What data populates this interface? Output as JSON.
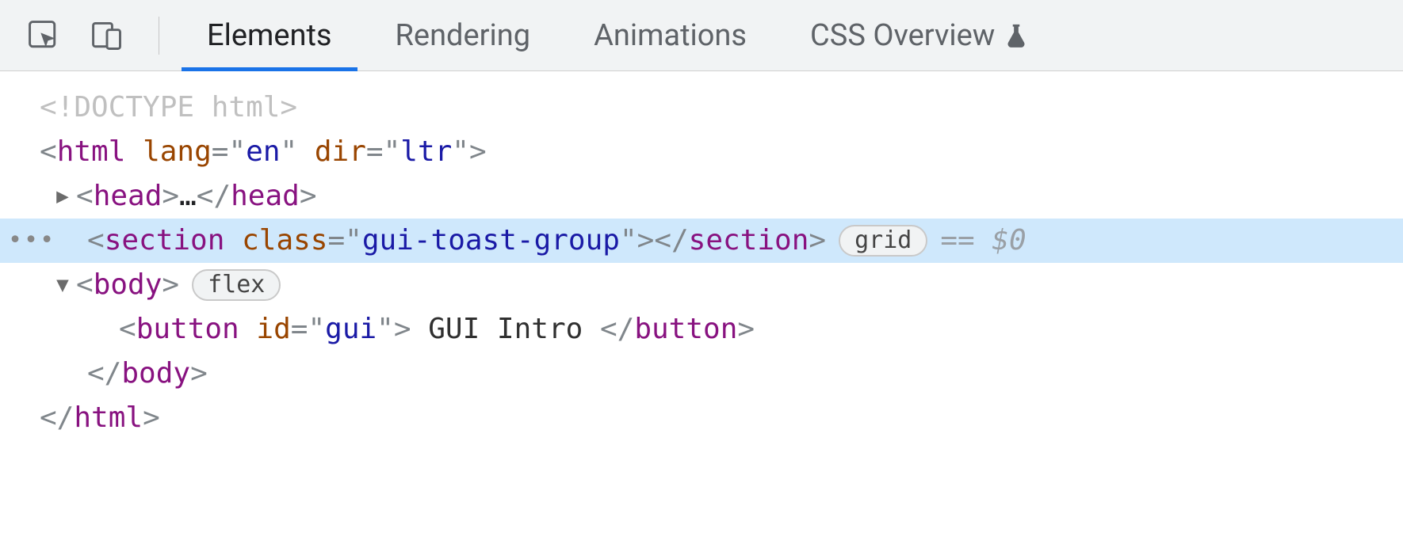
{
  "toolbar": {
    "tabs": [
      {
        "label": "Elements",
        "active": true
      },
      {
        "label": "Rendering",
        "active": false
      },
      {
        "label": "Animations",
        "active": false
      },
      {
        "label": "CSS Overview",
        "active": false,
        "beaker": true
      }
    ]
  },
  "dom": {
    "doctype": "<!DOCTYPE html>",
    "html_open": {
      "tag": "html",
      "attrs": [
        [
          "lang",
          "en"
        ],
        [
          "dir",
          "ltr"
        ]
      ]
    },
    "head": {
      "tag": "head",
      "folded_label": "…"
    },
    "section": {
      "tag": "section",
      "attrs": [
        [
          "class",
          "gui-toast-group"
        ]
      ],
      "badge": "grid",
      "suffix_eq": "==",
      "suffix_var": "$0"
    },
    "body": {
      "tag": "body",
      "badge": "flex"
    },
    "button": {
      "tag": "button",
      "attrs": [
        [
          "id",
          "gui"
        ]
      ],
      "text": " GUI Intro "
    },
    "body_close_tag": "body",
    "html_close_tag": "html"
  }
}
